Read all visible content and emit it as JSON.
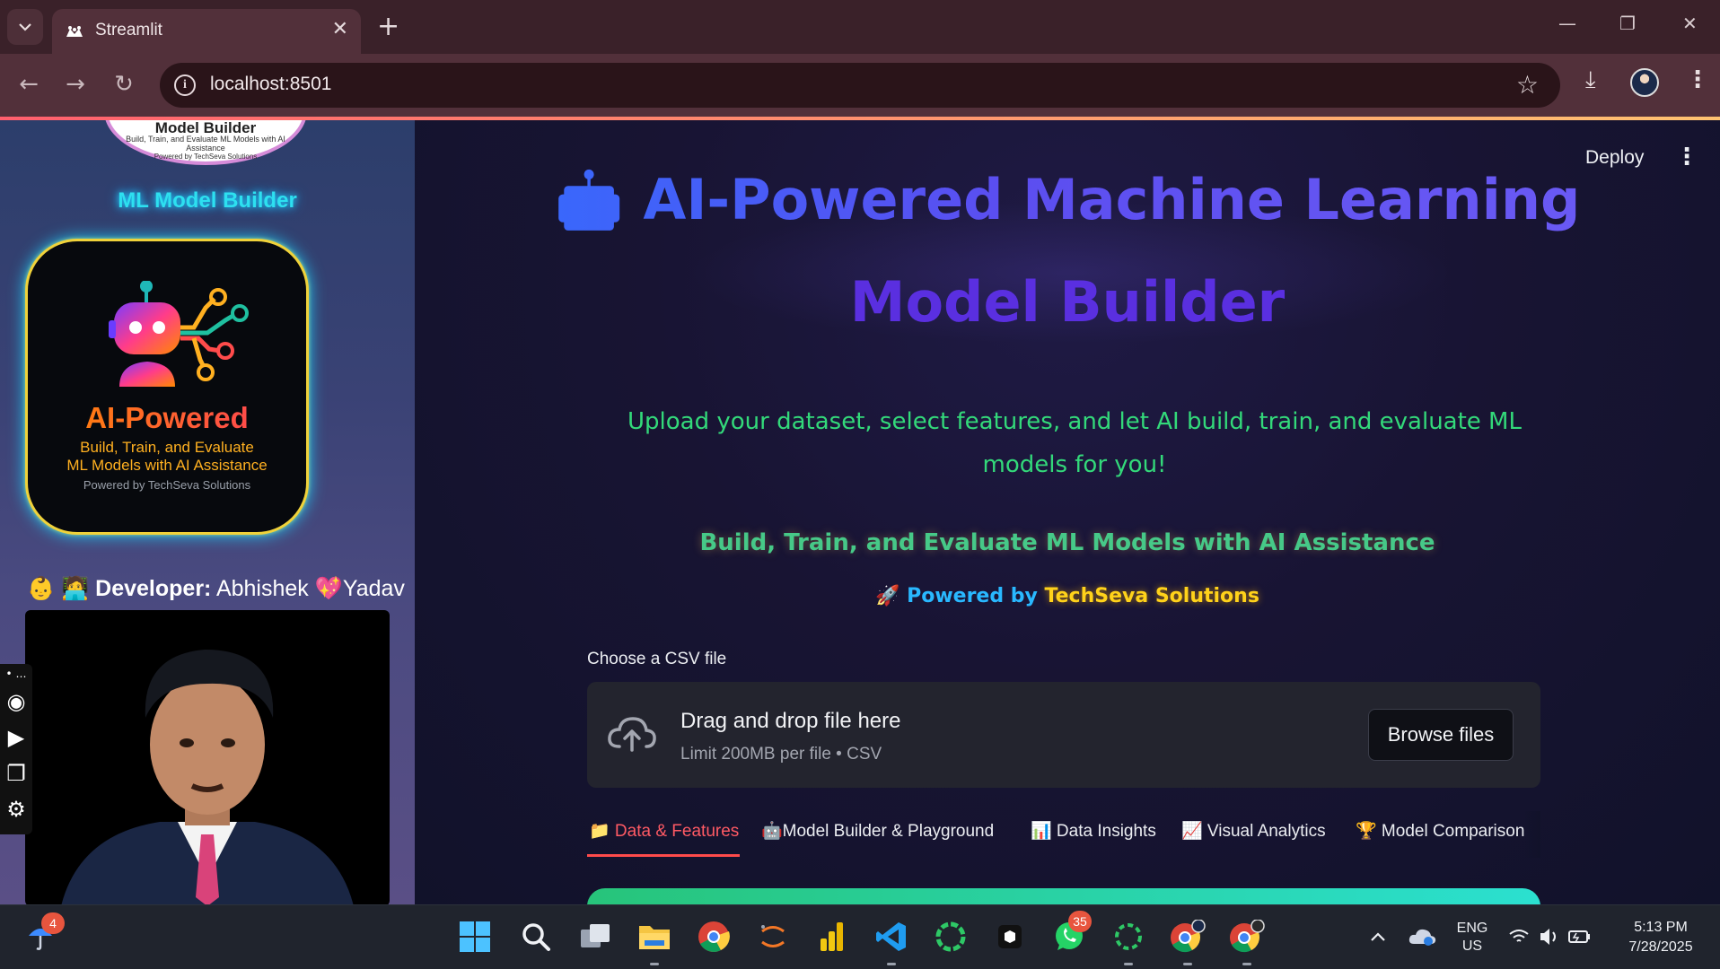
{
  "browser": {
    "tab_title": "Streamlit",
    "url": "localhost:8501",
    "new_tab": "+",
    "close_tab": "✕"
  },
  "sidebar": {
    "top_logo": {
      "title": "Model Builder",
      "subtitle": "Build, Train, and Evaluate ML Models with AI Assistance",
      "powered": "Powered by TechSeva Solutions"
    },
    "title": "ML Model Builder",
    "card": {
      "headline": "AI-Powered",
      "line1": "Build, Train, and Evaluate",
      "line2": "ML Models with AI Assistance",
      "powered": "Powered by TechSeva Solutions"
    },
    "developer_prefix": "👶 🧑‍💻 ",
    "developer_label": "Developer:",
    "developer_name_1": " Abhishek ",
    "developer_heart": "💖",
    "developer_name_2": "Yadav",
    "tools": [
      "camera-icon",
      "video-icon",
      "window-icon",
      "settings-icon"
    ]
  },
  "main": {
    "deploy_label": "Deploy",
    "hero_line1": "🤖 AI-Powered Machine Learning",
    "hero_line2": "Model Builder",
    "subtitle": "Upload your dataset, select features, and let AI build, train, and evaluate ML models for you!",
    "tagline": "Build, Train, and Evaluate ML Models with AI Assistance",
    "powered_prefix": "🚀 Powered by ",
    "powered_brand": "TechSeva Solutions",
    "upload": {
      "label": "Choose a CSV file",
      "drag_text": "Drag and drop file here",
      "limit_text": "Limit 200MB per file • CSV",
      "browse_label": "Browse files"
    },
    "tabs": [
      {
        "label": "📁 Data & Features"
      },
      {
        "label": "🤖Model Builder & Playground"
      },
      {
        "label": "📊 Data Insights"
      },
      {
        "label": "📈 Visual Analytics"
      },
      {
        "label": "🏆 Model Comparison"
      }
    ]
  },
  "taskbar": {
    "weather_badge": "4",
    "whatsapp_badge": "35",
    "lang_line1": "ENG",
    "lang_line2": "US",
    "time": "5:13 PM",
    "date": "7/28/2025"
  },
  "colors": {
    "accent_red": "#ff4b4b",
    "hero_blue": "#2f6fff",
    "subtitle_green": "#33d97a",
    "brand_yellow": "#ffd21a"
  }
}
